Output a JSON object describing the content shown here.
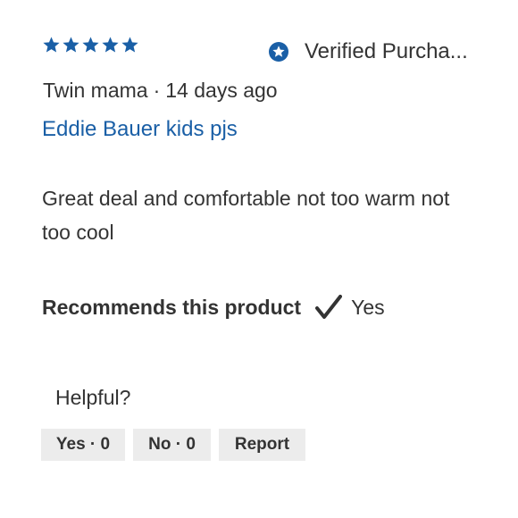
{
  "review": {
    "rating": 5,
    "rating_max": 5,
    "star_color": "#1a5fa6",
    "verified_label": "Verified Purcha...",
    "verified_icon": "star-badge-icon",
    "author": "Twin mama",
    "separator": "·",
    "posted": "14 days ago",
    "title": "Eddie Bauer kids pjs",
    "title_color": "#1a5fa6",
    "body": "Great deal and comfortable not too warm not too cool",
    "recommend_label": "Recommends this product",
    "recommend_icon": "checkmark-icon",
    "recommend_value": "Yes"
  },
  "feedback": {
    "question": "Helpful?",
    "yes_label": "Yes · 0",
    "no_label": "No · 0",
    "report_label": "Report"
  }
}
